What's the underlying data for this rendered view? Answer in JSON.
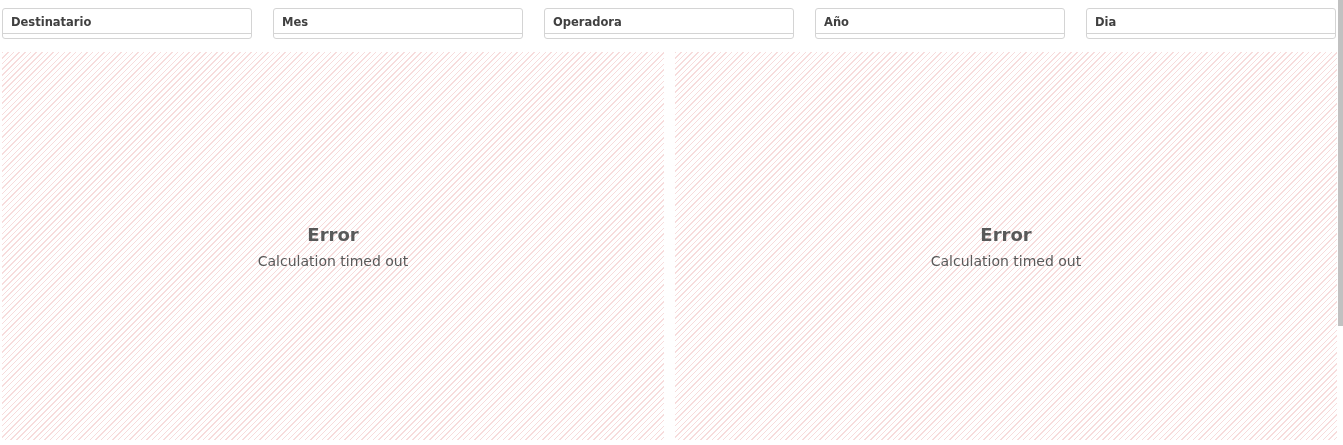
{
  "filters": [
    {
      "label": "Destinatario"
    },
    {
      "label": "Mes"
    },
    {
      "label": "Operadora"
    },
    {
      "label": "Año"
    },
    {
      "label": "Dia"
    }
  ],
  "panels": [
    {
      "title": "Error",
      "message": "Calculation timed out"
    },
    {
      "title": "Error",
      "message": "Calculation timed out"
    }
  ]
}
